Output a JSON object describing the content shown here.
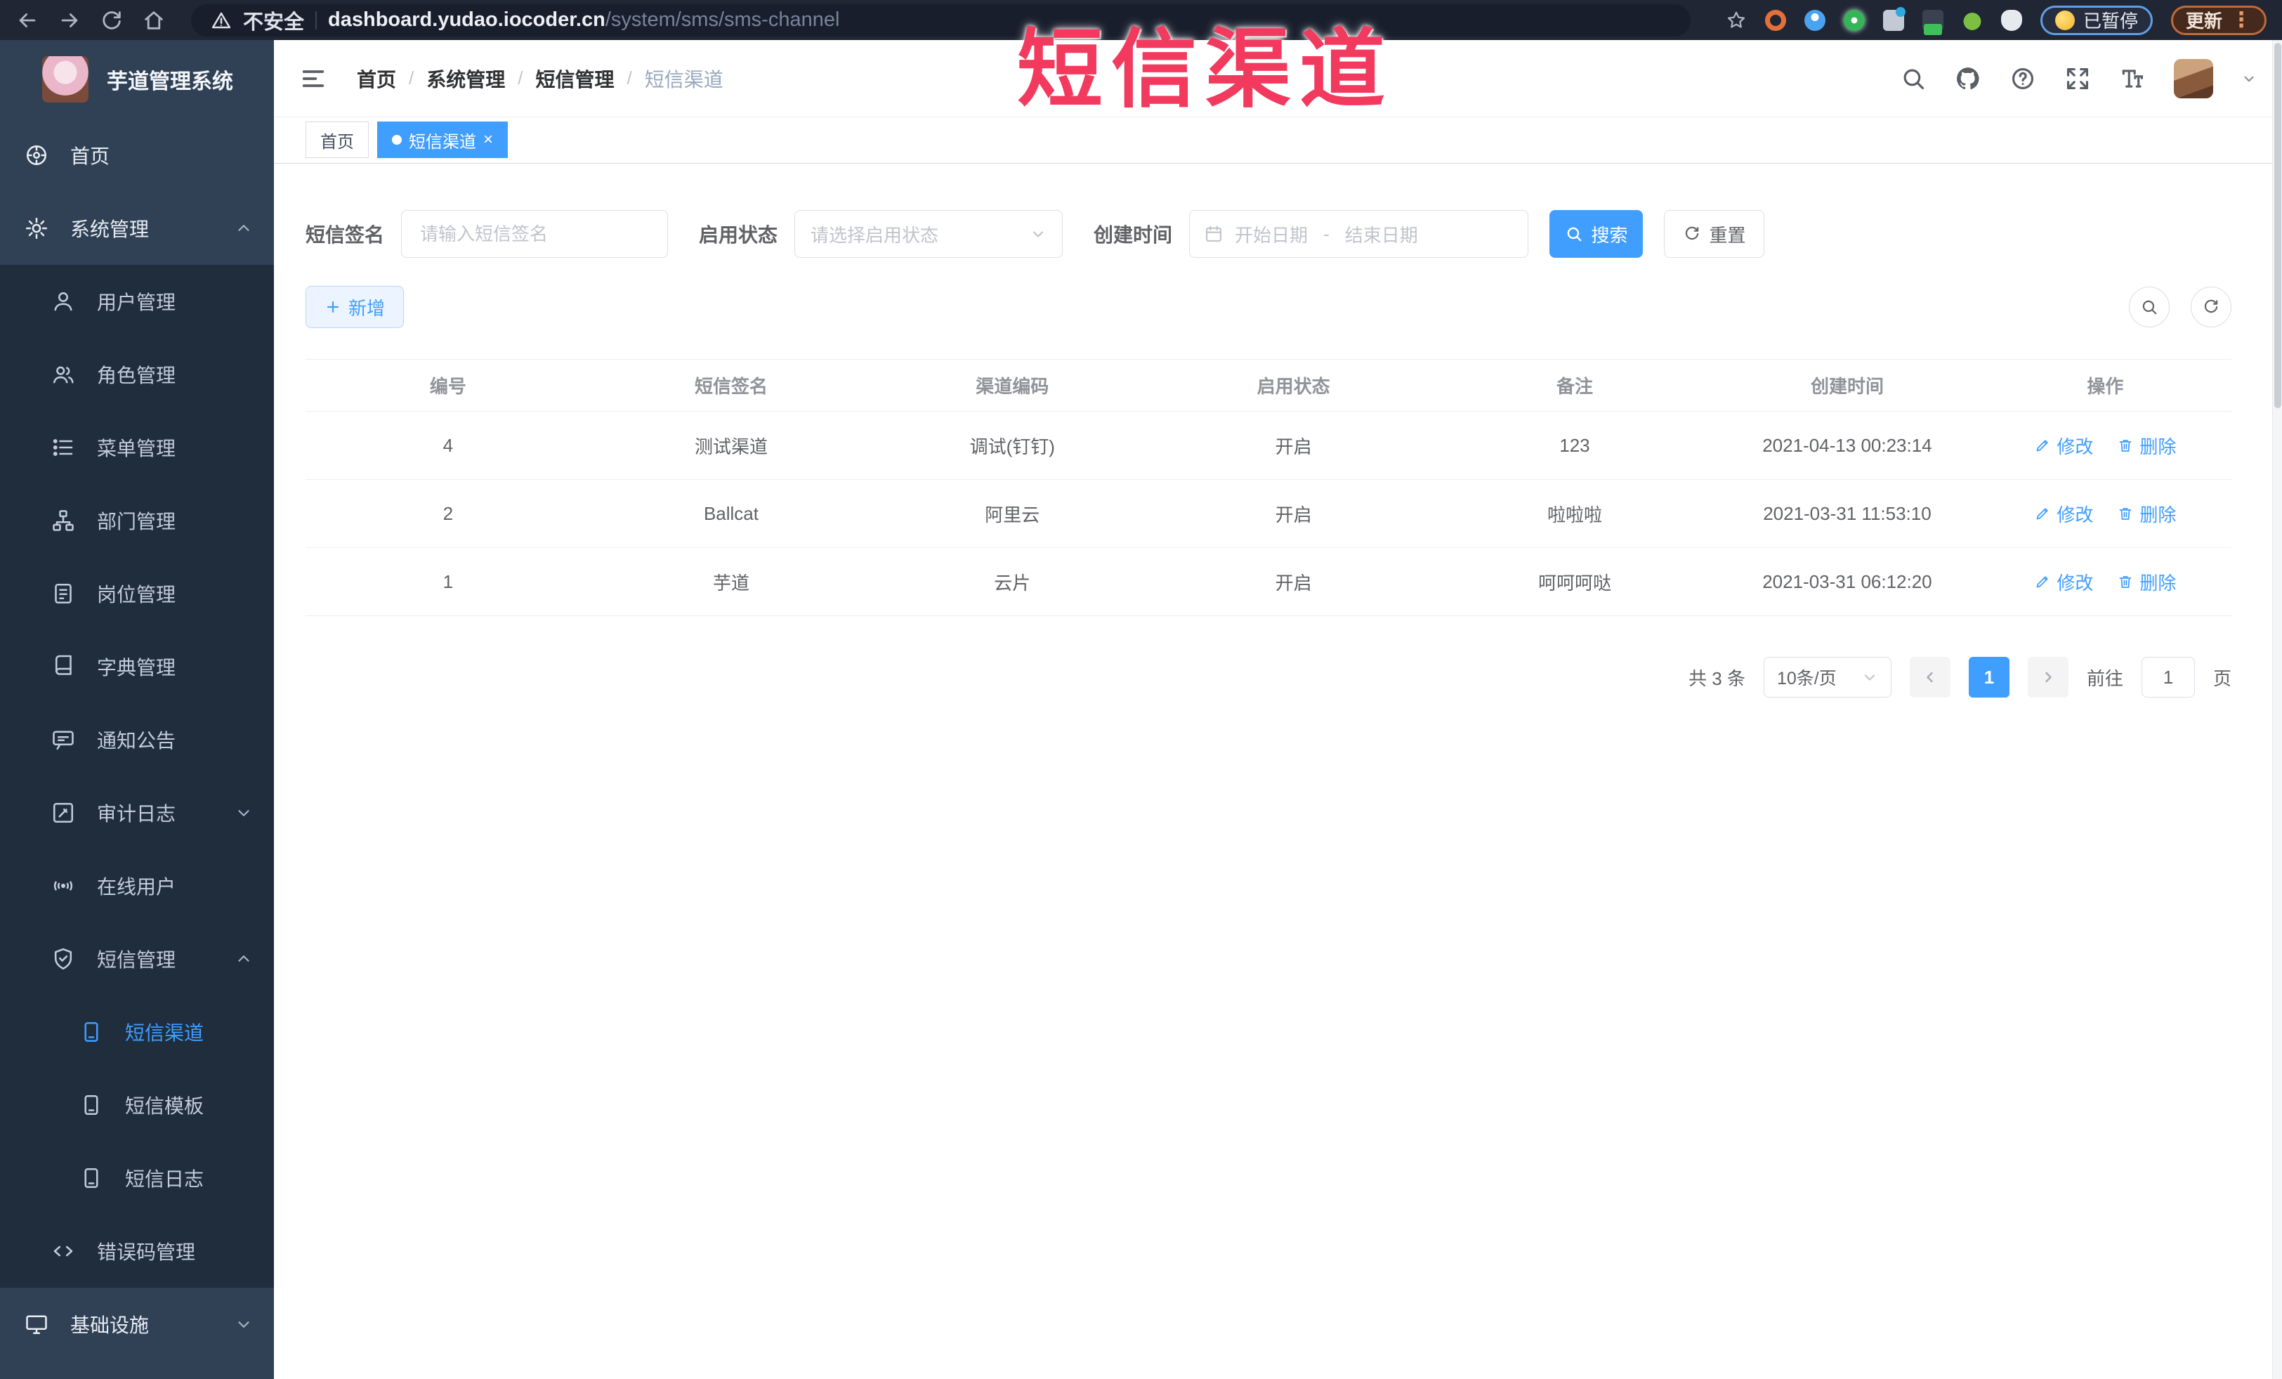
{
  "browser": {
    "security": "不安全",
    "url_host": "dashboard.yudao.iocoder.cn",
    "url_path": "/system/sms/sms-channel",
    "paused_badge": "已暂停",
    "update_button": "更新",
    "icons": [
      "back-icon",
      "forward-icon",
      "reload-icon",
      "home-icon",
      "warning-icon",
      "bookmark-star-icon",
      "extension-icons",
      "emoji-extension-icon",
      "browser-menu-kebab-icon"
    ]
  },
  "overlay": {
    "title": "短信渠道",
    "color": "#f23a5e"
  },
  "sidebar": {
    "app_title": "芋道管理系统",
    "items": [
      {
        "label": "首页",
        "icon": "dashboard-icon",
        "level": 1
      },
      {
        "label": "系统管理",
        "icon": "gear-icon",
        "level": 1,
        "expanded": true
      },
      {
        "label": "用户管理",
        "icon": "user-icon",
        "level": 2
      },
      {
        "label": "角色管理",
        "icon": "role-icon",
        "level": 2
      },
      {
        "label": "菜单管理",
        "icon": "menu-list-icon",
        "level": 2
      },
      {
        "label": "部门管理",
        "icon": "dept-tree-icon",
        "level": 2
      },
      {
        "label": "岗位管理",
        "icon": "post-icon",
        "level": 2
      },
      {
        "label": "字典管理",
        "icon": "dict-icon",
        "level": 2
      },
      {
        "label": "通知公告",
        "icon": "notice-icon",
        "level": 2
      },
      {
        "label": "审计日志",
        "icon": "audit-icon",
        "level": 2,
        "collapsed": true
      },
      {
        "label": "在线用户",
        "icon": "online-icon",
        "level": 2
      },
      {
        "label": "短信管理",
        "icon": "sms-shield-icon",
        "level": 2,
        "expanded": true
      },
      {
        "label": "短信渠道",
        "icon": "doc-icon",
        "level": 3,
        "active": true
      },
      {
        "label": "短信模板",
        "icon": "doc-icon",
        "level": 3
      },
      {
        "label": "短信日志",
        "icon": "doc-icon",
        "level": 3
      },
      {
        "label": "错误码管理",
        "icon": "code-icon",
        "level": 2
      },
      {
        "label": "基础设施",
        "icon": "infra-icon",
        "level": 1,
        "collapsed": true
      }
    ]
  },
  "breadcrumb": {
    "items": [
      "首页",
      "系统管理",
      "短信管理",
      "短信渠道"
    ],
    "separator": "/"
  },
  "header_icons": [
    "search-icon",
    "github-icon",
    "help-icon",
    "fullscreen-icon",
    "font-size-icon",
    "avatar",
    "chevron-down-icon"
  ],
  "tabs": {
    "close_glyph": "×",
    "list": [
      {
        "label": "首页",
        "active": false
      },
      {
        "label": "短信渠道",
        "active": true
      }
    ]
  },
  "filters": {
    "sign_label": "短信签名",
    "sign_placeholder": "请输入短信签名",
    "status_label": "启用状态",
    "status_placeholder": "请选择启用状态",
    "time_label": "创建时间",
    "start_placeholder": "开始日期",
    "range_separator": "-",
    "end_placeholder": "结束日期",
    "search_label": "搜索",
    "reset_label": "重置"
  },
  "toolbar": {
    "add_label": "新增"
  },
  "table": {
    "columns": [
      "编号",
      "短信签名",
      "渠道编码",
      "启用状态",
      "备注",
      "创建时间",
      "操作"
    ],
    "rows": [
      {
        "id": "4",
        "sign": "测试渠道",
        "code": "调试(钉钉)",
        "status": "开启",
        "remark": "123",
        "created": "2021-04-13 00:23:14"
      },
      {
        "id": "2",
        "sign": "Ballcat",
        "code": "阿里云",
        "status": "开启",
        "remark": "啦啦啦",
        "created": "2021-03-31 11:53:10"
      },
      {
        "id": "1",
        "sign": "芋道",
        "code": "云片",
        "status": "开启",
        "remark": "呵呵呵哒",
        "created": "2021-03-31 06:12:20"
      }
    ],
    "actions": {
      "edit": "修改",
      "delete": "删除"
    }
  },
  "pagination": {
    "total_label": "共 3 条",
    "page_size_label": "10条/页",
    "current_page": "1",
    "goto_label": "前往",
    "goto_value": "1",
    "page_unit": "页"
  },
  "colors": {
    "primary": "#409eff",
    "sidebar_bg": "#304156",
    "submenu_bg": "#1f2d3d",
    "overlay_red": "#f23a5e"
  }
}
